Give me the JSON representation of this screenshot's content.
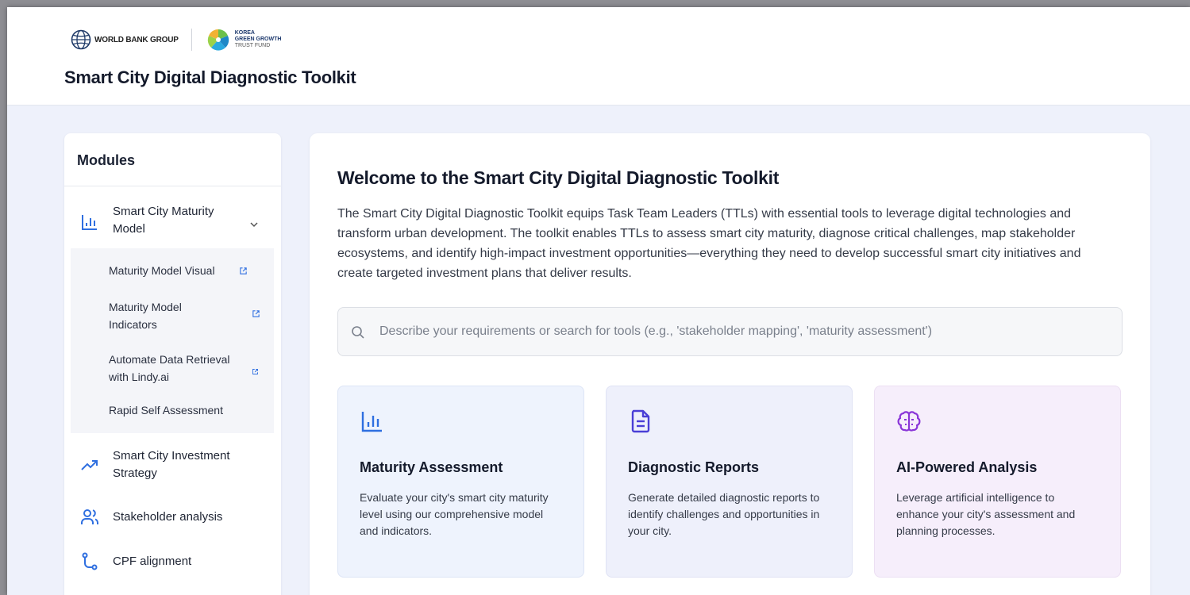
{
  "header": {
    "wbg_logo_text": "WORLD BANK GROUP",
    "kgg_logo_lines": [
      "KOREA",
      "GREEN GROWTH",
      "TRUST FUND"
    ],
    "app_title": "Smart City Digital Diagnostic Toolkit"
  },
  "sidebar": {
    "title": "Modules",
    "items": [
      {
        "label": "Smart City Maturity Model",
        "icon": "bar-chart-icon",
        "expanded": true
      },
      {
        "label": "Smart City Investment Strategy",
        "icon": "trending-up-icon"
      },
      {
        "label": "Stakeholder analysis",
        "icon": "users-icon"
      },
      {
        "label": "CPF alignment",
        "icon": "route-icon"
      }
    ],
    "subitems": [
      {
        "label": "Maturity Model Visual",
        "icon": "external-link-icon"
      },
      {
        "label": "Maturity Model Indicators",
        "icon": "external-link-icon"
      },
      {
        "label": "Automate Data Retrieval with Lindy.ai",
        "icon": "external-link-icon"
      },
      {
        "label": "Rapid Self Assessment"
      }
    ]
  },
  "main": {
    "welcome_title": "Welcome to the Smart City Digital Diagnostic Toolkit",
    "intro": "The Smart City Digital Diagnostic Toolkit equips Task Team Leaders (TTLs) with essential tools to leverage digital technologies and transform urban development. The toolkit enables TTLs to assess smart city maturity, diagnose critical challenges, map stakeholder ecosystems, and identify high-impact investment opportunities—everything they need to develop successful smart city initiatives and create targeted investment plans that deliver results.",
    "search": {
      "placeholder": "Describe your requirements or search for tools (e.g., 'stakeholder mapping', 'maturity assessment')",
      "value": ""
    },
    "cards": [
      {
        "title": "Maturity Assessment",
        "desc": "Evaluate your city's smart city maturity level using our comprehensive model and indicators.",
        "icon": "bar-chart-icon",
        "color": "#2f6fe0"
      },
      {
        "title": "Diagnostic Reports",
        "desc": "Generate detailed diagnostic reports to identify challenges and opportunities in your city.",
        "icon": "document-icon",
        "color": "#4a3fd6"
      },
      {
        "title": "AI-Powered Analysis",
        "desc": "Leverage artificial intelligence to enhance your city's assessment and planning processes.",
        "icon": "brain-icon",
        "color": "#8a35d8"
      }
    ]
  },
  "colors": {
    "page_bg": "#eef1fb",
    "text_primary": "#141a2b",
    "accent_blue": "#2f6fe0"
  }
}
